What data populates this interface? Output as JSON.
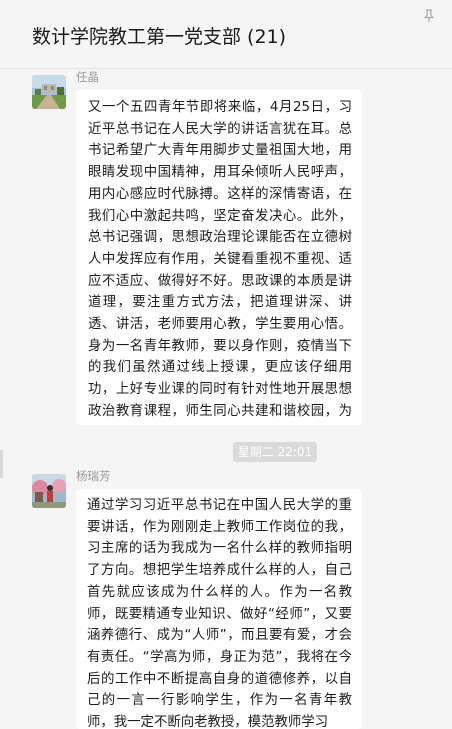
{
  "chat": {
    "title": "数计学院教工第一党支部 (21)"
  },
  "icons": {
    "pin": "pin-icon"
  },
  "messages": [
    {
      "sender": "任晶",
      "text": "又一个五四青年节即将来临，4月25日，习近平总书记在人民大学的讲话言犹在耳。总书记希望广大青年用脚步丈量祖国大地，用眼睛发现中国精神，用耳朵倾听人民呼声，用内心感应时代脉搏。这样的深情寄语，在我们心中激起共鸣，坚定奋发决心。此外，总书记强调，思想政治理论课能否在立德树人中发挥应有作用，关键看重视不重视、适应不适应、做得好不好。思政课的本质是讲道理，要注重方式方法，把道理讲深、讲透、讲活，老师要用心教，学生要用心悟。身为一名青年教师，要以身作则，疫情当下的我们虽然通过线上授课，更应该仔细用功，上好专业课的同时有针对性地开展思想政治教育课程，师生同心共建和谐校园，为师大的发展奉献自己的力量。"
    },
    {
      "time": "星期二 22:01",
      "sender": "杨瑞芳",
      "text": "通过学习习近平总书记在中国人民大学的重要讲话，作为刚刚走上教师工作岗位的我，习主席的话为我成为一名什么样的教师指明了方向。想把学生培养成什么样的人，自己首先就应该成为什么样的人。作为一名教师，既要精通专业知识、做好“经师”，又要涵养德行、成为“人师”，而且要有爱，才会有责任。“学高为师，身正为范”，我将在今后的工作中不断提高自身的道德修养，以自己的一言一行影响学生，作为一名青年教师，我一定不断向老教授，模范教师学习"
    }
  ]
}
